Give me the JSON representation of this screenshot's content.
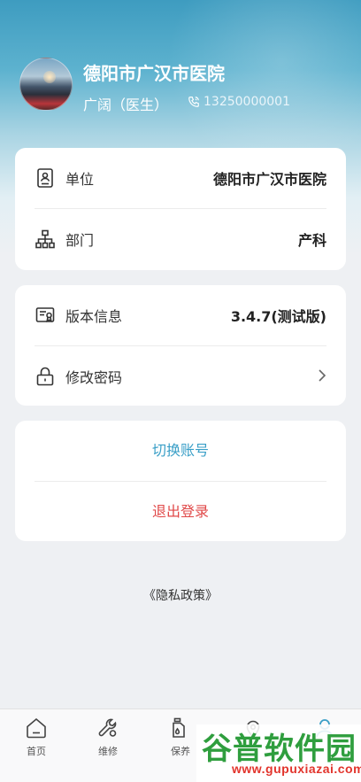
{
  "profile": {
    "hospital": "德阳市广汉市医院",
    "user_role": "广阔（医生）",
    "phone": "13250000001"
  },
  "info_card": {
    "unit": {
      "label": "单位",
      "value": "德阳市广汉市医院",
      "icon": "id-badge-icon"
    },
    "department": {
      "label": "部门",
      "value": "产科",
      "icon": "org-chart-icon"
    }
  },
  "settings_card": {
    "version": {
      "label": "版本信息",
      "value": "3.4.7(测试版)",
      "icon": "certificate-icon"
    },
    "password": {
      "label": "修改密码",
      "icon": "lock-icon"
    }
  },
  "actions": {
    "switch_account": "切换账号",
    "logout": "退出登录"
  },
  "privacy_policy": "《隐私政策》",
  "tabbar": {
    "items": [
      {
        "label": "首页",
        "icon": "home-icon"
      },
      {
        "label": "维修",
        "icon": "wrench-icon"
      },
      {
        "label": "保养",
        "icon": "oil-can-icon"
      },
      {
        "label": "",
        "icon": "location-icon"
      },
      {
        "label": "",
        "icon": "user-icon"
      }
    ]
  },
  "watermark": {
    "text": "谷普软件园",
    "url": "www.gupuxiazai.com"
  },
  "colors": {
    "accent_blue": "#3a9fc7",
    "logout_red": "#e04848",
    "header_top": "#3e9cc0"
  }
}
